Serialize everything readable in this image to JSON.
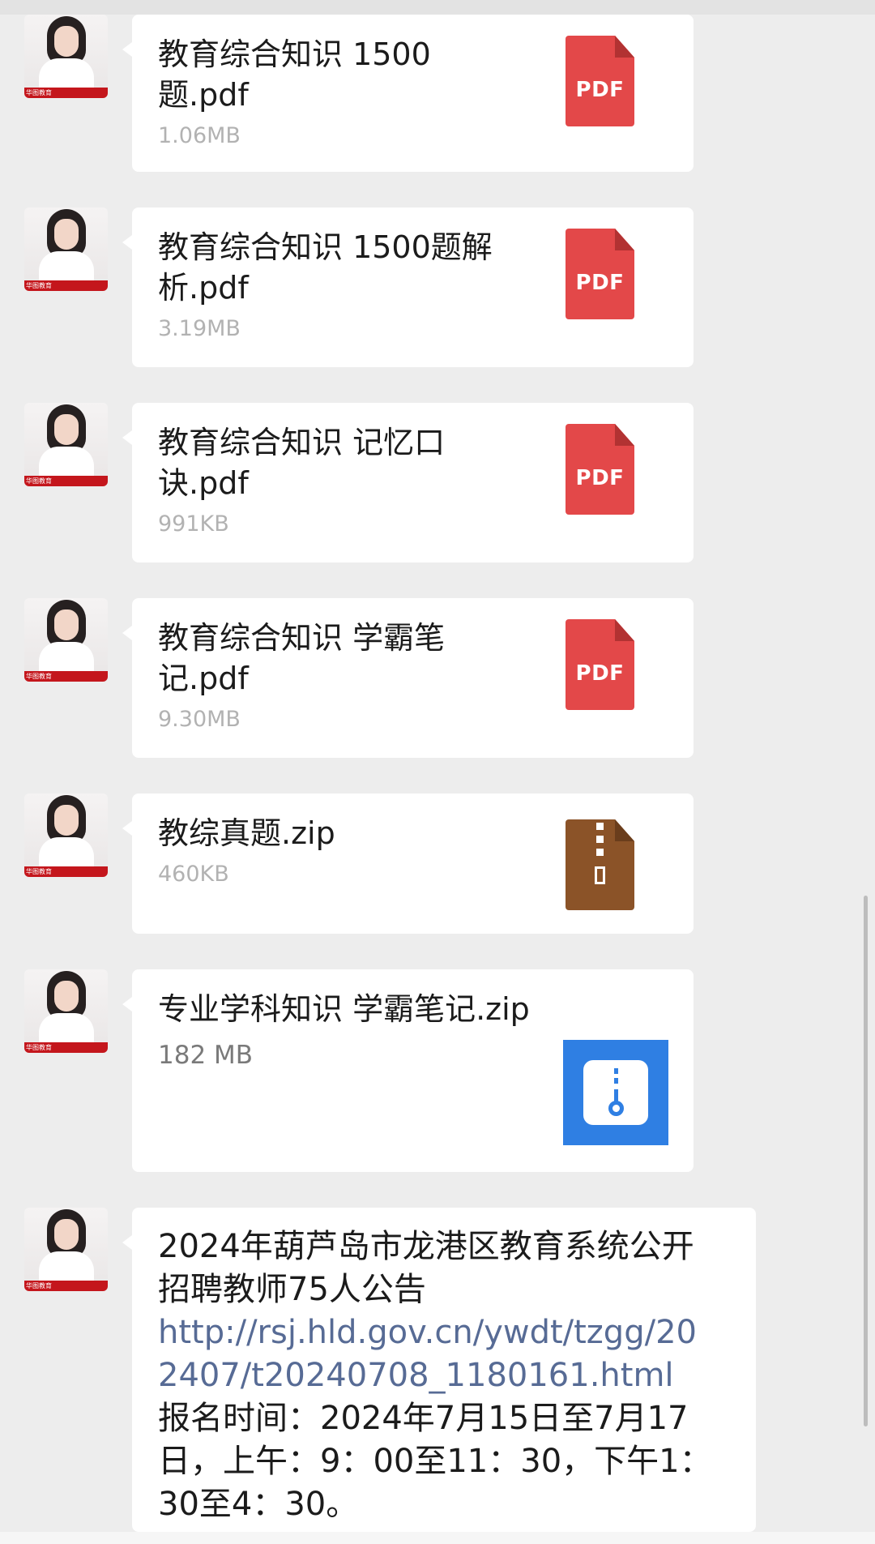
{
  "chat": {
    "sender_avatar_label": "华图教育",
    "messages": [
      {
        "type": "file",
        "name": "教育综合知识 1500题.pdf",
        "size": "1.06MB",
        "icon": "pdf-file-icon",
        "icon_label": "PDF"
      },
      {
        "type": "file",
        "name": "教育综合知识 1500题解析.pdf",
        "size": "3.19MB",
        "icon": "pdf-file-icon",
        "icon_label": "PDF"
      },
      {
        "type": "file",
        "name": "教育综合知识 记忆口诀.pdf",
        "size": "991KB",
        "icon": "pdf-file-icon",
        "icon_label": "PDF"
      },
      {
        "type": "file",
        "name": "教育综合知识 学霸笔记.pdf",
        "size": "9.30MB",
        "icon": "pdf-file-icon",
        "icon_label": "PDF"
      },
      {
        "type": "file",
        "name": "教综真题.zip",
        "size": "460KB",
        "icon": "zip-file-icon"
      },
      {
        "type": "file",
        "name": "专业学科知识 学霸笔记.zip",
        "size": "182 MB",
        "icon": "zip-archive-icon"
      },
      {
        "type": "text",
        "text_before": "2024年葫芦岛市龙港区教育系统公开招聘教师75人公告",
        "link": "http://rsj.hld.gov.cn/ywdt/tzgg/202407/t20240708_1180161.html",
        "text_after": "报名时间：2024年7月15日至7月17日，上午：9：00至11：30，下午1：30至4：30。"
      }
    ]
  },
  "colors": {
    "background": "#ededed",
    "bubble": "#ffffff",
    "pdf_red": "#e34849",
    "zip_brown": "#8b5328",
    "zip_blue": "#2f7fe3",
    "link": "#576b95"
  }
}
